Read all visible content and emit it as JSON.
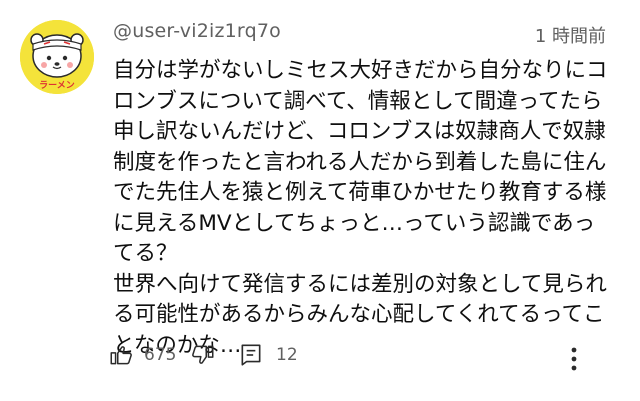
{
  "comment": {
    "author": "@user-vi2iz1rq7o",
    "time": "1 時間前",
    "avatar_text": "ラーメン",
    "text": "自分は学がないしミセス大好きだから自分なりにコ\nロンブスについて調べて、情報として間違ってたら\n申し訳ないんだけど、コロンブスは奴隷商人で奴隷\n制度を作ったと言われる人だから到着した島に住ん\nでた先住人を猿と例えて荷車ひかせたり教育する様\nに見えるMVとしてちょっと…っていう認識であっ\nてる？\n世界へ向けて発信するには差別の対象として見られ\nる可能性があるからみんな心配してくれてるってこ\nとなのかな…",
    "likes": "675",
    "replies": "12"
  },
  "icons": {
    "like": "thumbs-up-icon",
    "dislike": "thumbs-down-icon",
    "reply": "reply-icon",
    "more": "more-vertical-icon"
  },
  "colors": {
    "avatar_bg": "#f4e33a",
    "secondary_text": "#606060",
    "primary_text": "#0f0f0f"
  }
}
